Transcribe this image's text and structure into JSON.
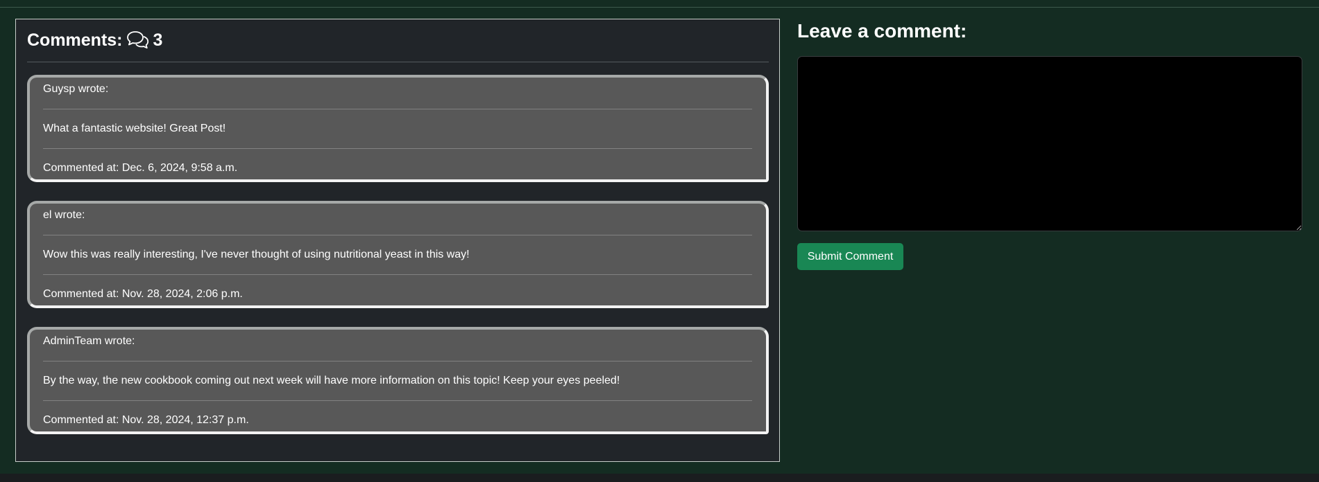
{
  "comments_section": {
    "title": "Comments:",
    "icon": "chat-bubbles-icon",
    "count": "3",
    "comments": [
      {
        "author_line": "Guysp wrote:",
        "body": "What a fantastic website! Great Post!",
        "timestamp": "Commented at: Dec. 6, 2024, 9:58 a.m."
      },
      {
        "author_line": "el wrote:",
        "body": "Wow this was really interesting, I've never thought of using nutritional yeast in this way!",
        "timestamp": "Commented at: Nov. 28, 2024, 2:06 p.m."
      },
      {
        "author_line": "AdminTeam wrote:",
        "body": "By the way, the new cookbook coming out next week will have more information on this topic! Keep your eyes peeled!",
        "timestamp": "Commented at: Nov. 28, 2024, 12:37 p.m."
      }
    ]
  },
  "comment_form": {
    "title": "Leave a comment:",
    "textarea_value": "",
    "submit_label": "Submit Comment"
  },
  "colors": {
    "page_background": "#142c22",
    "panel_background": "#212529",
    "card_background": "#585858",
    "submit_button": "#198754"
  }
}
